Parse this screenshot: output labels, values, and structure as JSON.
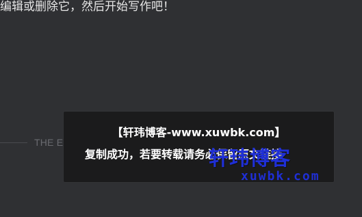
{
  "article": {
    "body_text": "编辑或删除它，然后开始写作吧！",
    "end_label": "THE END"
  },
  "toast": {
    "line1": "【轩玮博客-www.xuwbk.com】",
    "line2": "复制成功，若要转载请务必保留原文链接"
  },
  "watermark": {
    "chinese": "轩玮博客",
    "latin": "xuwbk.com"
  },
  "colors": {
    "background": "#2f3033",
    "toast_background": "#1b1b1c",
    "toast_text": "#ffffff",
    "watermark": "#1f2fd6"
  }
}
